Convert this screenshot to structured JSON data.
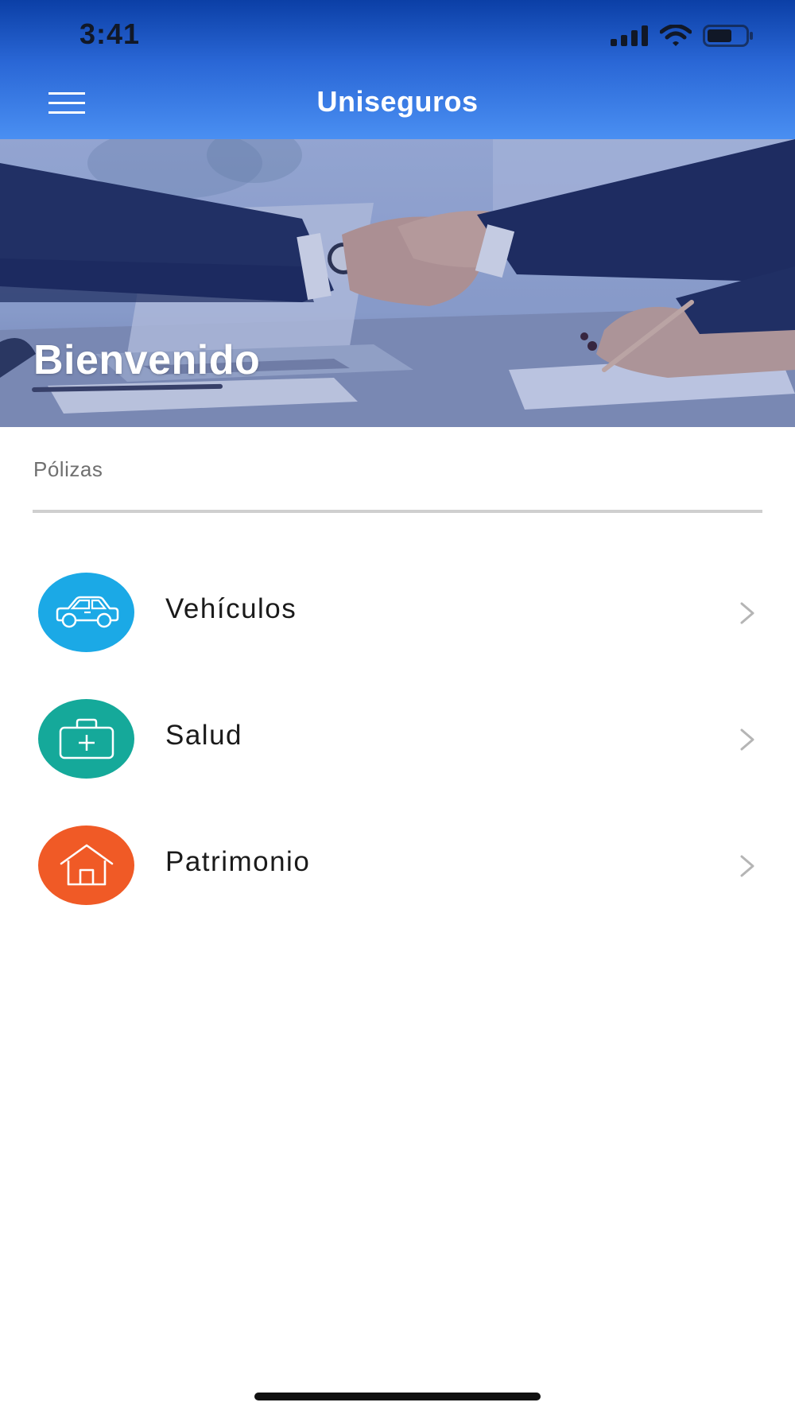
{
  "status_bar": {
    "time": "3:41",
    "icons": [
      "cellular-signal-icon",
      "wifi-icon",
      "battery-icon"
    ]
  },
  "header": {
    "title": "Uniseguros",
    "menu_icon": "hamburger-menu-icon"
  },
  "hero": {
    "title": "Bienvenido",
    "image": "business-handshake-photo"
  },
  "section": {
    "label": "Pólizas"
  },
  "policies": [
    {
      "label": "Vehículos",
      "icon": "car-icon",
      "color": "#1BA9E6"
    },
    {
      "label": "Salud",
      "icon": "medical-briefcase-icon",
      "color": "#15A99A"
    },
    {
      "label": "Patrimonio",
      "icon": "house-icon",
      "color": "#F05A26"
    }
  ],
  "colors": {
    "header_top": "#0b3fa6",
    "header_bottom": "#4a8ff2",
    "divider": "#cfcfcf",
    "chevron": "#b5b5b5"
  }
}
